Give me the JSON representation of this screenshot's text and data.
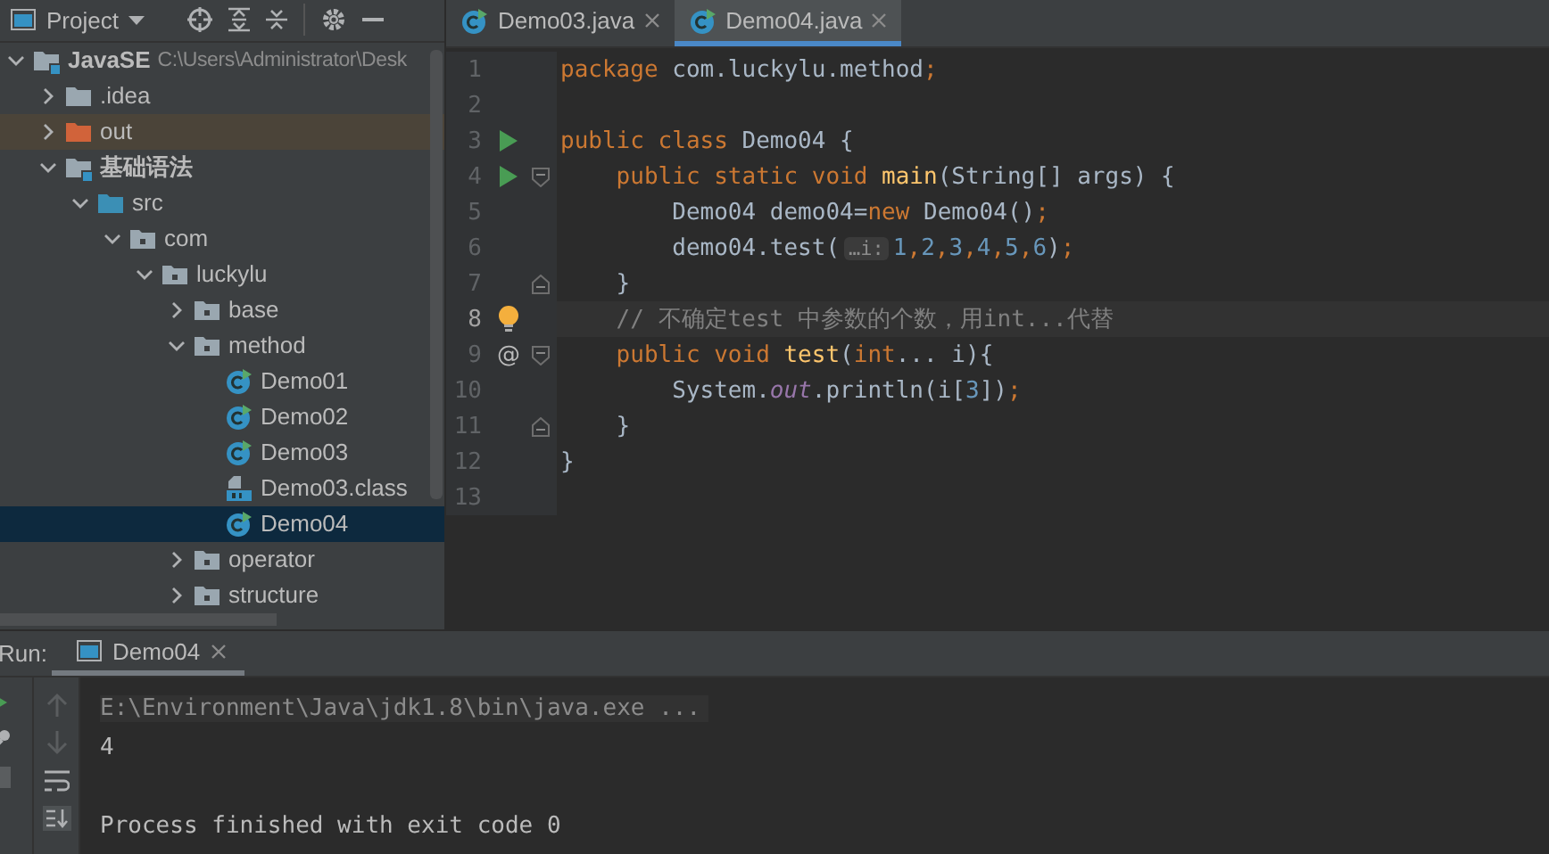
{
  "project_header": {
    "title": "Project"
  },
  "tree": [
    {
      "label": "JavaSE",
      "path": "C:\\Users\\Administrator\\Desk",
      "kind": "module",
      "expanded": true,
      "selected": false,
      "children": [
        {
          "label": ".idea",
          "kind": "folder",
          "expanded": false,
          "selected": false
        },
        {
          "label": "out",
          "kind": "excluded",
          "expanded": false,
          "selected": false
        },
        {
          "label": "基础语法",
          "kind": "module",
          "expanded": true,
          "selected": false,
          "children": [
            {
              "label": "src",
              "kind": "source",
              "expanded": true,
              "selected": false,
              "children": [
                {
                  "label": "com",
                  "kind": "package",
                  "expanded": true,
                  "selected": false,
                  "children": [
                    {
                      "label": "luckylu",
                      "kind": "package",
                      "expanded": true,
                      "selected": false,
                      "children": [
                        {
                          "label": "base",
                          "kind": "package",
                          "expanded": false,
                          "selected": false
                        },
                        {
                          "label": "method",
                          "kind": "package",
                          "expanded": true,
                          "selected": false,
                          "children": [
                            {
                              "label": "Demo01",
                              "kind": "class",
                              "selected": false
                            },
                            {
                              "label": "Demo02",
                              "kind": "class",
                              "selected": false
                            },
                            {
                              "label": "Demo03",
                              "kind": "class",
                              "selected": false
                            },
                            {
                              "label": "Demo03.class",
                              "kind": "classfile",
                              "selected": false
                            },
                            {
                              "label": "Demo04",
                              "kind": "class",
                              "selected": true
                            }
                          ]
                        },
                        {
                          "label": "operator",
                          "kind": "package",
                          "expanded": false,
                          "selected": false
                        },
                        {
                          "label": "structure",
                          "kind": "package",
                          "expanded": false,
                          "selected": false
                        }
                      ]
                    }
                  ]
                }
              ]
            }
          ]
        }
      ]
    }
  ],
  "editor_tabs": [
    {
      "label": "Demo03.java",
      "selected": false
    },
    {
      "label": "Demo04.java",
      "selected": true
    }
  ],
  "code": [
    {
      "number": "1",
      "current": false,
      "tokens": [
        {
          "text": "package ",
          "kind": "keyword"
        },
        {
          "text": "com.luckylu.method",
          "kind": "plain"
        },
        {
          "text": ";",
          "kind": "keyword"
        }
      ]
    },
    {
      "number": "2",
      "current": false
    },
    {
      "number": "3",
      "current": false,
      "gutter": [
        {
          "kind": "run"
        }
      ],
      "tokens": [
        {
          "text": "public class ",
          "kind": "keyword"
        },
        {
          "text": "Demo04 {",
          "kind": "plain"
        }
      ]
    },
    {
      "number": "4",
      "current": false,
      "gutter": [
        {
          "kind": "run"
        },
        {
          "kind": "fold_open"
        }
      ],
      "tokens": [
        {
          "text": "    public static void ",
          "kind": "keyword"
        },
        {
          "text": "main",
          "kind": "function"
        },
        {
          "text": "(String[] args) {",
          "kind": "plain"
        }
      ]
    },
    {
      "number": "5",
      "current": false,
      "tokens": [
        {
          "text": "        Demo04 demo04=",
          "kind": "plain"
        },
        {
          "text": "new ",
          "kind": "keyword"
        },
        {
          "text": "Demo04()",
          "kind": "plain"
        },
        {
          "text": ";",
          "kind": "keyword"
        }
      ]
    },
    {
      "number": "6",
      "current": false,
      "tokens": [
        {
          "text": "        demo04.test(",
          "kind": "plain"
        },
        {
          "text": "…i:",
          "kind": "hint"
        },
        {
          "text": "1",
          "kind": "number"
        },
        {
          "text": ",",
          "kind": "keyword"
        },
        {
          "text": "2",
          "kind": "number"
        },
        {
          "text": ",",
          "kind": "keyword"
        },
        {
          "text": "3",
          "kind": "number"
        },
        {
          "text": ",",
          "kind": "keyword"
        },
        {
          "text": "4",
          "kind": "number"
        },
        {
          "text": ",",
          "kind": "keyword"
        },
        {
          "text": "5",
          "kind": "number"
        },
        {
          "text": ",",
          "kind": "keyword"
        },
        {
          "text": "6",
          "kind": "number"
        },
        {
          "text": ")",
          "kind": "plain"
        },
        {
          "text": ";",
          "kind": "keyword"
        }
      ]
    },
    {
      "number": "7",
      "current": false,
      "gutter": [
        {
          "kind": "fold_close"
        }
      ],
      "tokens": [
        {
          "text": "    }",
          "kind": "plain"
        }
      ]
    },
    {
      "number": "8",
      "current": true,
      "gutter": [
        {
          "kind": "bulb"
        }
      ],
      "tokens": [
        {
          "text": "    // 不确定test 中参数的个数，用int...代替",
          "kind": "comment"
        }
      ]
    },
    {
      "number": "9",
      "current": false,
      "gutter": [
        {
          "kind": "override",
          "text": "@"
        },
        {
          "kind": "fold_open"
        }
      ],
      "tokens": [
        {
          "text": "    public void ",
          "kind": "keyword"
        },
        {
          "text": "test",
          "kind": "function"
        },
        {
          "text": "(",
          "kind": "plain"
        },
        {
          "text": "int",
          "kind": "keyword"
        },
        {
          "text": "... i){",
          "kind": "plain"
        }
      ]
    },
    {
      "number": "10",
      "current": false,
      "tokens": [
        {
          "text": "        System.",
          "kind": "plain"
        },
        {
          "text": "out",
          "kind": "field"
        },
        {
          "text": ".println(i[",
          "kind": "plain"
        },
        {
          "text": "3",
          "kind": "number"
        },
        {
          "text": "])",
          "kind": "plain"
        },
        {
          "text": ";",
          "kind": "keyword"
        }
      ]
    },
    {
      "number": "11",
      "current": false,
      "gutter": [
        {
          "kind": "fold_close"
        }
      ],
      "tokens": [
        {
          "text": "    }",
          "kind": "plain"
        }
      ]
    },
    {
      "number": "12",
      "current": false,
      "tokens": [
        {
          "text": "}",
          "kind": "plain"
        }
      ]
    },
    {
      "number": "13",
      "current": false
    }
  ],
  "run_panel": {
    "label": "Run:",
    "tab": "Demo04",
    "output": [
      {
        "text": "E:\\Environment\\Java\\jdk1.8\\bin\\java.exe ...",
        "kind": "command"
      },
      {
        "text": "4",
        "kind": "stdout"
      },
      {
        "kind": "blank"
      },
      {
        "text": "Process finished with exit code 0",
        "kind": "stdout"
      }
    ]
  }
}
